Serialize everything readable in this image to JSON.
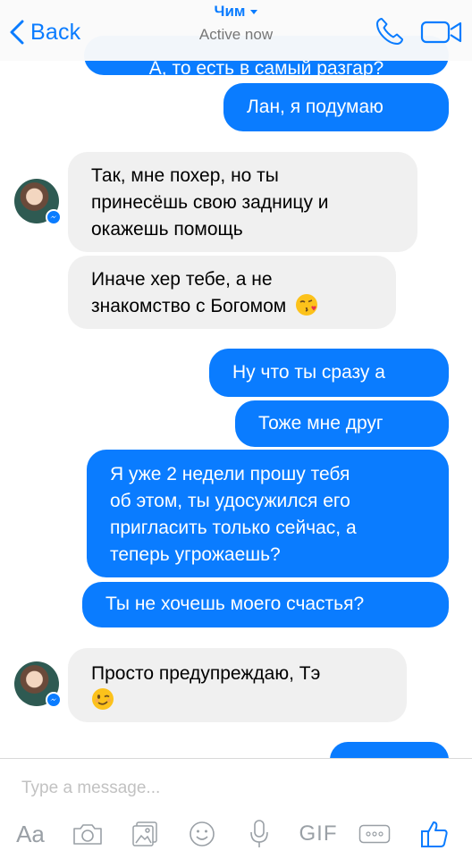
{
  "header": {
    "back_label": "Back",
    "contact_name": "Чим",
    "status": "Active now"
  },
  "messages": {
    "partial_top": "А, то есть в самый разгар?",
    "m1": "Лан, я подумаю",
    "m2_l1": "Так, мне похер, но ты",
    "m2_l2": "принесёшь свою задницу и",
    "m2_l3": "окажешь помощь",
    "m3_l1": "Иначе хер тебе, а не",
    "m3_l2": "знакомство с Богомом",
    "m4": "Ну что ты сразу а",
    "m5": "Тоже мне друг",
    "m6_l1": "Я уже 2 недели прошу тебя",
    "m6_l2": "об этом, ты удосужился его",
    "m6_l3": "пригласить только сейчас, а",
    "m6_l4": "теперь угрожаешь?",
    "m7": "Ты не хочешь моего счастья?",
    "m8_l1": "Просто предупреждаю, Тэ"
  },
  "composer": {
    "placeholder": "Type a message...",
    "aa_label": "Aa",
    "gif_label": "GIF"
  },
  "colors": {
    "accent": "#0a7cff",
    "incoming_bubble": "#f0f0f0"
  },
  "icons": [
    "back-chevron-icon",
    "phone-icon",
    "video-camera-icon",
    "messenger-badge-icon",
    "camera-icon",
    "photo-icon",
    "emoji-icon",
    "microphone-icon",
    "more-icon",
    "thumbs-up-icon",
    "kissing-emoji-icon",
    "winking-emoji-icon"
  ]
}
